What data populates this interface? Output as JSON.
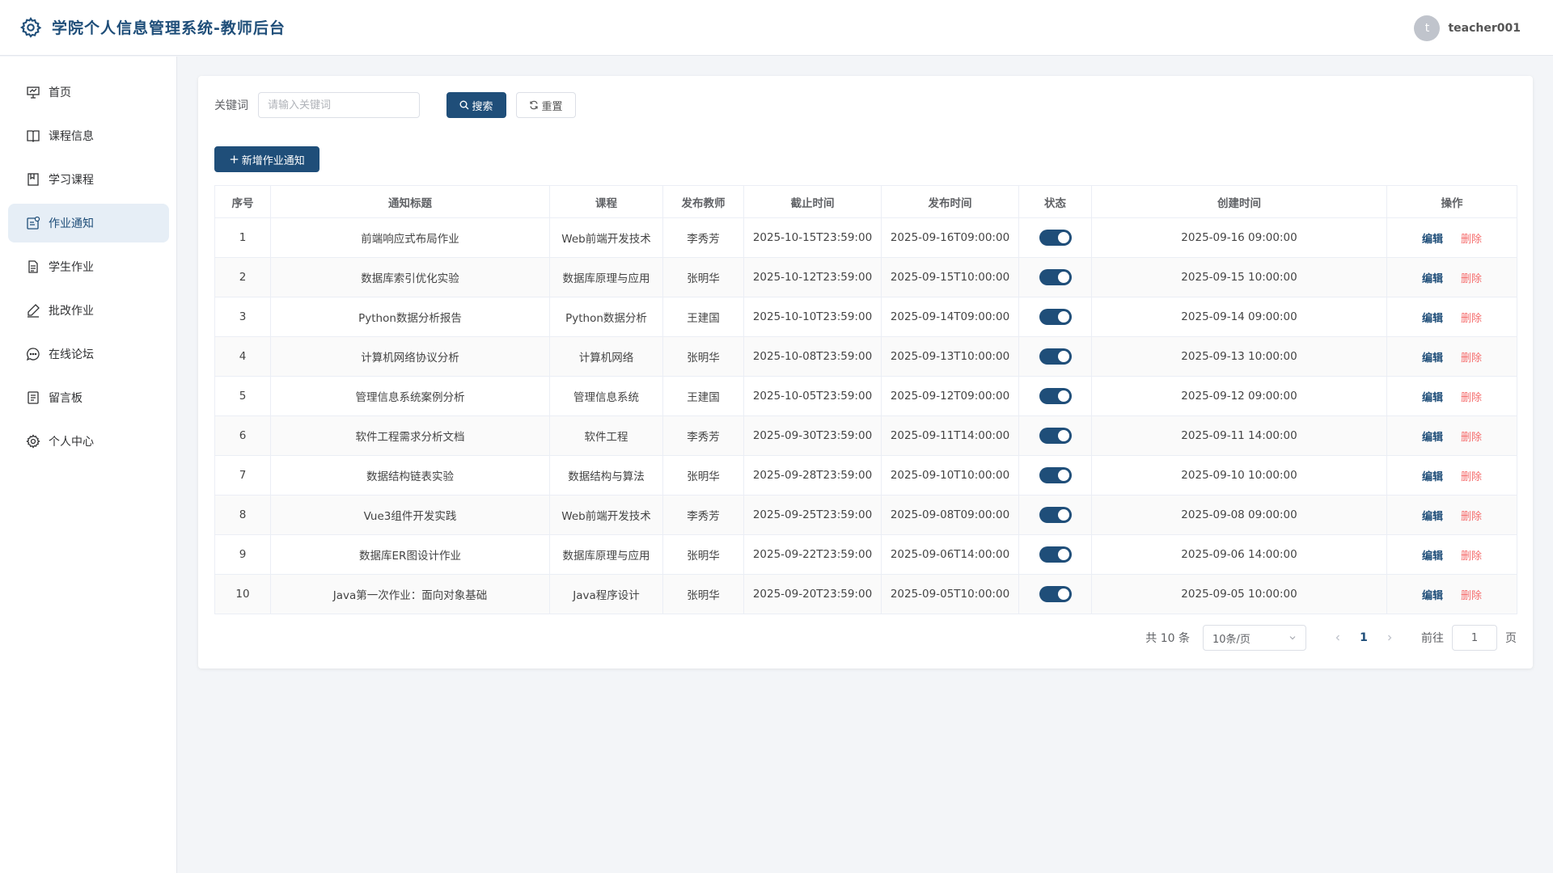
{
  "header": {
    "title": "学院个人信息管理系统-教师后台",
    "avatar_initial": "t",
    "username": "teacher001"
  },
  "sidebar": {
    "items": [
      {
        "label": "首页",
        "icon": "presentation-icon"
      },
      {
        "label": "课程信息",
        "icon": "book-open-icon"
      },
      {
        "label": "学习课程",
        "icon": "notebook-icon"
      },
      {
        "label": "作业通知",
        "icon": "notice-icon",
        "active": true
      },
      {
        "label": "学生作业",
        "icon": "document-icon"
      },
      {
        "label": "批改作业",
        "icon": "pen-icon"
      },
      {
        "label": "在线论坛",
        "icon": "chat-icon"
      },
      {
        "label": "留言板",
        "icon": "memo-icon"
      },
      {
        "label": "个人中心",
        "icon": "gear-icon"
      }
    ]
  },
  "search": {
    "label": "关键词",
    "placeholder": "请输入关键词",
    "value": "",
    "search_label": "搜索",
    "reset_label": "重置"
  },
  "toolbar": {
    "add_label": "新增作业通知"
  },
  "table": {
    "columns": [
      "序号",
      "通知标题",
      "课程",
      "发布教师",
      "截止时间",
      "发布时间",
      "状态",
      "创建时间",
      "操作"
    ],
    "edit_label": "编辑",
    "delete_label": "删除",
    "rows": [
      {
        "no": "1",
        "title": "前端响应式布局作业",
        "course": "Web前端开发技术",
        "teacher": "李秀芳",
        "deadline": "2025-10-15T23:59:00",
        "publish": "2025-09-16T09:00:00",
        "status": true,
        "created": "2025-09-16 09:00:00"
      },
      {
        "no": "2",
        "title": "数据库索引优化实验",
        "course": "数据库原理与应用",
        "teacher": "张明华",
        "deadline": "2025-10-12T23:59:00",
        "publish": "2025-09-15T10:00:00",
        "status": true,
        "created": "2025-09-15 10:00:00"
      },
      {
        "no": "3",
        "title": "Python数据分析报告",
        "course": "Python数据分析",
        "teacher": "王建国",
        "deadline": "2025-10-10T23:59:00",
        "publish": "2025-09-14T09:00:00",
        "status": true,
        "created": "2025-09-14 09:00:00"
      },
      {
        "no": "4",
        "title": "计算机网络协议分析",
        "course": "计算机网络",
        "teacher": "张明华",
        "deadline": "2025-10-08T23:59:00",
        "publish": "2025-09-13T10:00:00",
        "status": true,
        "created": "2025-09-13 10:00:00"
      },
      {
        "no": "5",
        "title": "管理信息系统案例分析",
        "course": "管理信息系统",
        "teacher": "王建国",
        "deadline": "2025-10-05T23:59:00",
        "publish": "2025-09-12T09:00:00",
        "status": true,
        "created": "2025-09-12 09:00:00"
      },
      {
        "no": "6",
        "title": "软件工程需求分析文档",
        "course": "软件工程",
        "teacher": "李秀芳",
        "deadline": "2025-09-30T23:59:00",
        "publish": "2025-09-11T14:00:00",
        "status": true,
        "created": "2025-09-11 14:00:00"
      },
      {
        "no": "7",
        "title": "数据结构链表实验",
        "course": "数据结构与算法",
        "teacher": "张明华",
        "deadline": "2025-09-28T23:59:00",
        "publish": "2025-09-10T10:00:00",
        "status": true,
        "created": "2025-09-10 10:00:00"
      },
      {
        "no": "8",
        "title": "Vue3组件开发实践",
        "course": "Web前端开发技术",
        "teacher": "李秀芳",
        "deadline": "2025-09-25T23:59:00",
        "publish": "2025-09-08T09:00:00",
        "status": true,
        "created": "2025-09-08 09:00:00"
      },
      {
        "no": "9",
        "title": "数据库ER图设计作业",
        "course": "数据库原理与应用",
        "teacher": "张明华",
        "deadline": "2025-09-22T23:59:00",
        "publish": "2025-09-06T14:00:00",
        "status": true,
        "created": "2025-09-06 14:00:00"
      },
      {
        "no": "10",
        "title": "Java第一次作业：面向对象基础",
        "course": "Java程序设计",
        "teacher": "张明华",
        "deadline": "2025-09-20T23:59:00",
        "publish": "2025-09-05T10:00:00",
        "status": true,
        "created": "2025-09-05 10:00:00"
      }
    ]
  },
  "pagination": {
    "total_text": "共 10 条",
    "page_size": "10条/页",
    "current_page": "1",
    "goto_label": "前往",
    "goto_value": "1",
    "page_suffix": "页"
  },
  "colors": {
    "primary": "#1f4e79",
    "danger": "#f56c6c",
    "active_bg": "#e6eef6"
  }
}
